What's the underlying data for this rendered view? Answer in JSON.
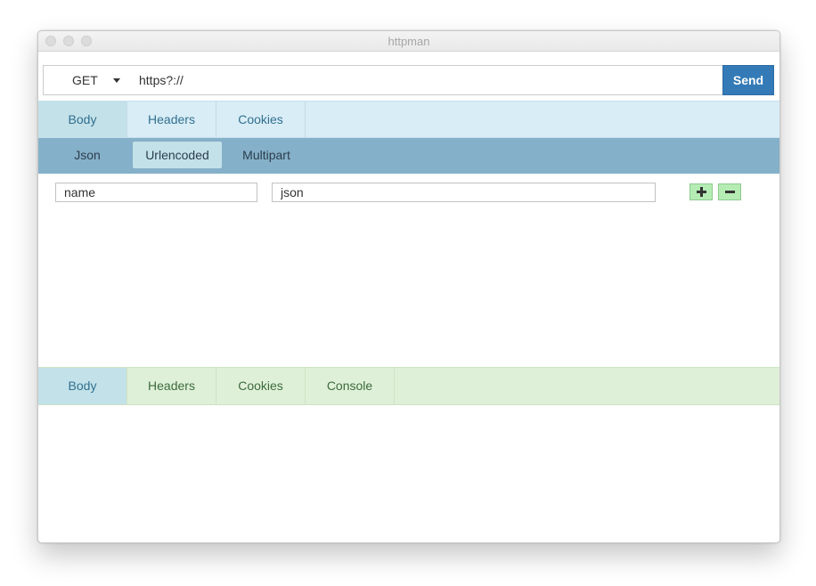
{
  "window": {
    "title": "httpman"
  },
  "request": {
    "method": "GET",
    "url": "https?://",
    "send_label": "Send"
  },
  "request_tabs": [
    {
      "label": "Body",
      "active": true
    },
    {
      "label": "Headers",
      "active": false
    },
    {
      "label": "Cookies",
      "active": false
    }
  ],
  "body_type_tabs": [
    {
      "label": "Json",
      "active": false
    },
    {
      "label": "Urlencoded",
      "active": true
    },
    {
      "label": "Multipart",
      "active": false
    }
  ],
  "params": [
    {
      "name": "name",
      "value": "json"
    }
  ],
  "param_actions": {
    "add_icon": "plus-icon",
    "remove_icon": "minus-icon"
  },
  "response_tabs": [
    {
      "label": "Body",
      "active": true
    },
    {
      "label": "Headers",
      "active": false
    },
    {
      "label": "Cookies",
      "active": false
    },
    {
      "label": "Console",
      "active": false
    }
  ],
  "colors": {
    "send": "#337ab7",
    "request_tabs_bg": "#d9edf7",
    "body_type_bar": "#85b0c9",
    "response_tabs_bg": "#dff0d8",
    "active_tab": "#c3e1e9",
    "add_remove_buttons": "#b4ecb4"
  }
}
